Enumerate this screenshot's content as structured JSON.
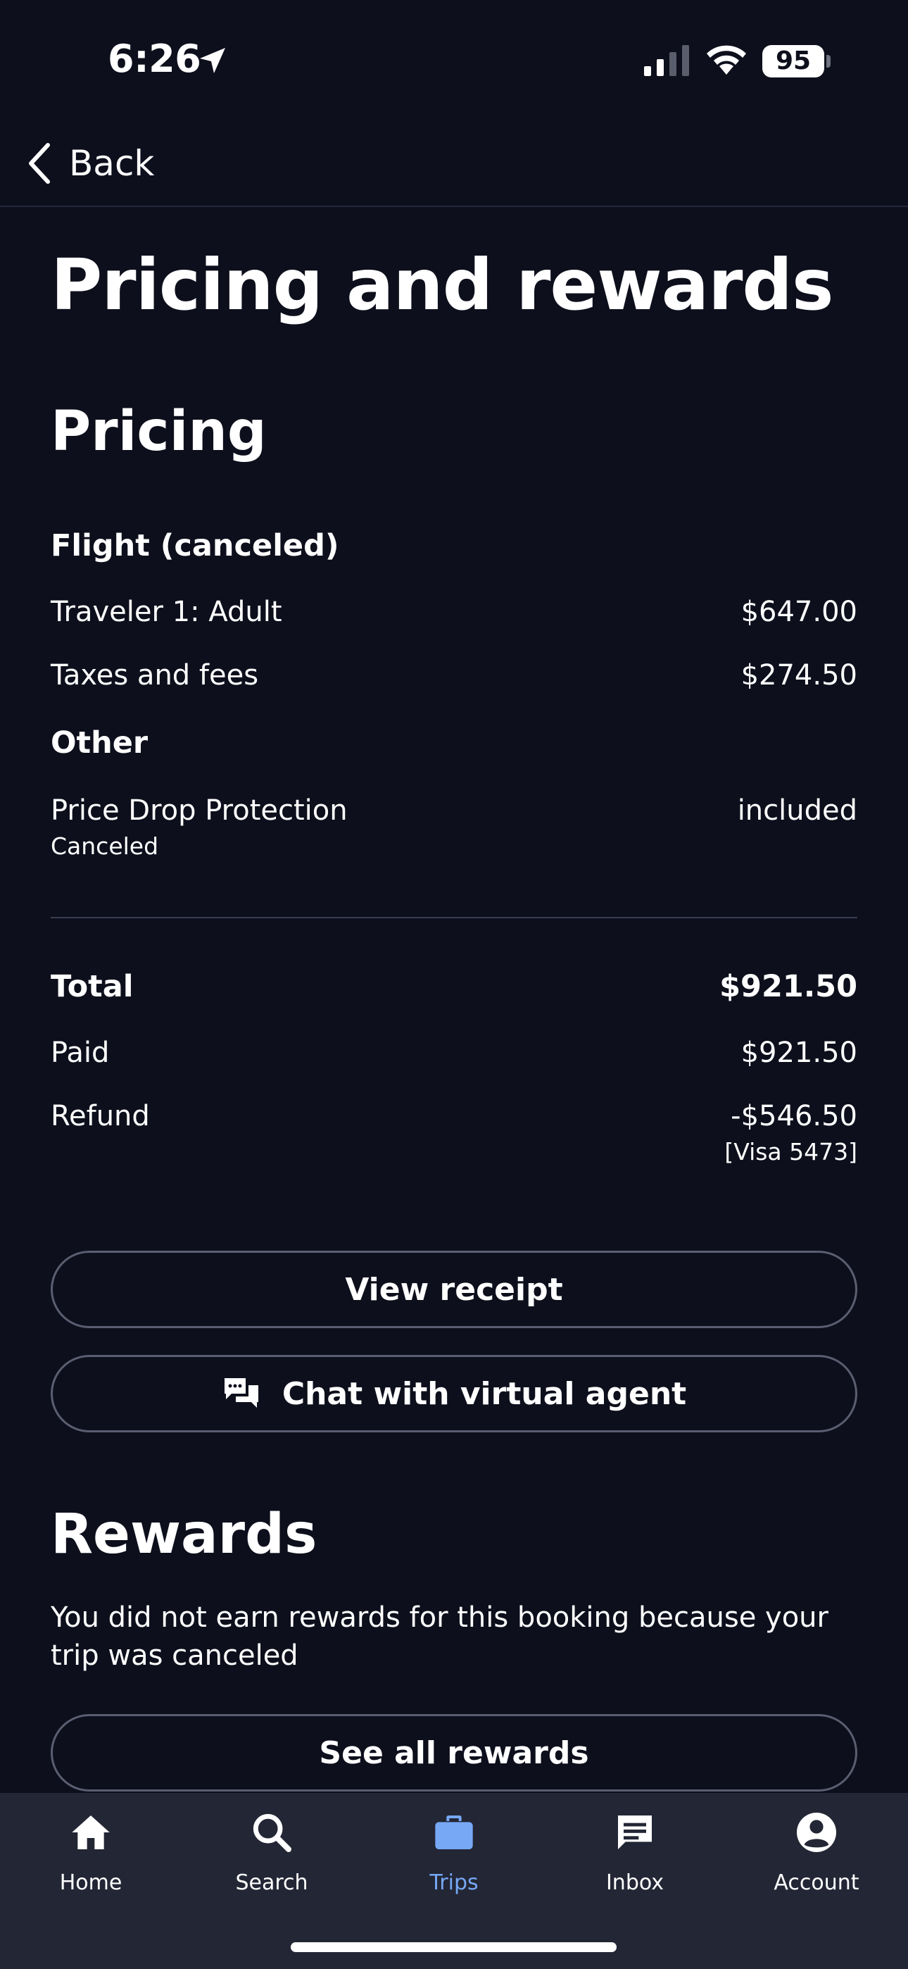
{
  "status_bar": {
    "time": "6:26",
    "battery": "95"
  },
  "header": {
    "back_label": "Back"
  },
  "page": {
    "title": "Pricing and rewards"
  },
  "pricing": {
    "title": "Pricing",
    "flight_heading": "Flight (canceled)",
    "traveler_label": "Traveler 1: Adult",
    "traveler_value": "$647.00",
    "taxes_label": "Taxes and fees",
    "taxes_value": "$274.50",
    "other_heading": "Other",
    "protection_label": "Price Drop Protection",
    "protection_status": "Canceled",
    "protection_value": "included",
    "total_label": "Total",
    "total_value": "$921.50",
    "paid_label": "Paid",
    "paid_value": "$921.50",
    "refund_label": "Refund",
    "refund_value": "-$546.50",
    "refund_card": "[Visa 5473]"
  },
  "buttons": {
    "view_receipt": "View receipt",
    "chat_agent": "Chat with virtual agent",
    "see_rewards": "See all rewards"
  },
  "rewards": {
    "title": "Rewards",
    "message": "You did not earn rewards for this booking because your trip was canceled"
  },
  "tab_bar": {
    "active_color": "#76a8f5",
    "items": [
      {
        "label": "Home",
        "icon": "home-icon"
      },
      {
        "label": "Search",
        "icon": "search-icon"
      },
      {
        "label": "Trips",
        "icon": "briefcase-icon"
      },
      {
        "label": "Inbox",
        "icon": "inbox-icon"
      },
      {
        "label": "Account",
        "icon": "account-icon"
      }
    ],
    "active_index": 2
  }
}
